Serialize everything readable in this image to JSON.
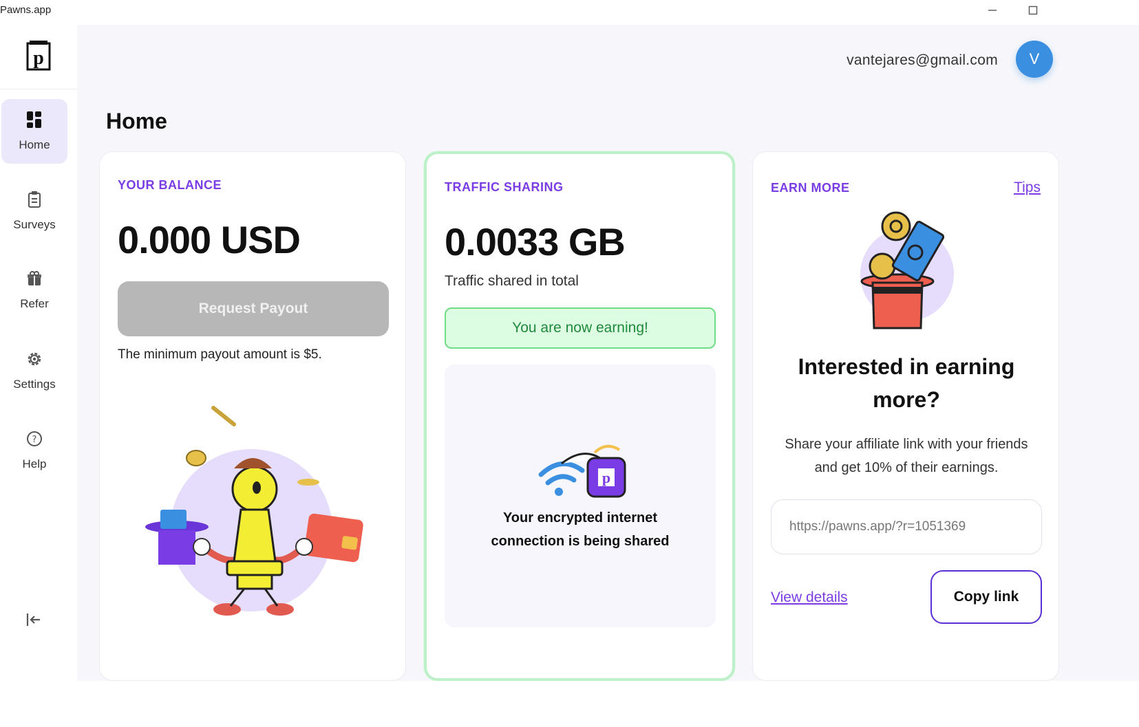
{
  "window": {
    "title": "Pawns.app",
    "minimize_icon": "minimize-icon",
    "maximize_icon": "maximize-icon"
  },
  "sidebar": {
    "logo": "P",
    "items": [
      {
        "label": "Home",
        "icon": "grid-icon",
        "active": true
      },
      {
        "label": "Surveys",
        "icon": "clipboard-icon"
      },
      {
        "label": "Refer",
        "icon": "gift-icon"
      },
      {
        "label": "Settings",
        "icon": "gear-icon"
      },
      {
        "label": "Help",
        "icon": "question-icon"
      }
    ],
    "collapse_icon": "collapse-icon"
  },
  "header": {
    "email": "vantejares@gmail.com",
    "avatar_letter": "V",
    "avatar_color": "#3b8fe0"
  },
  "page": {
    "title": "Home"
  },
  "balance": {
    "label": "YOUR BALANCE",
    "value": "0.000 USD",
    "button": "Request Payout",
    "note": "The minimum payout amount is $5."
  },
  "traffic": {
    "label": "TRAFFIC SHARING",
    "value": "0.0033 GB",
    "sub": "Traffic shared in total",
    "status": "You are now earning!",
    "message_line1": "Your encrypted internet",
    "message_line2": "connection is being shared"
  },
  "earn": {
    "label": "EARN MORE",
    "tips": "Tips",
    "title_line1": "Interested in earning",
    "title_line2": "more?",
    "desc_line1": "Share your affiliate link with your friends",
    "desc_line2": "and get 10% of their earnings.",
    "link_value": "https://pawns.app/?r=1051369",
    "view_details": "View details",
    "copy": "Copy link"
  },
  "colors": {
    "accent": "#7a3de5",
    "success": "#6fdd86",
    "button_disabled": "#b7b7b7"
  }
}
